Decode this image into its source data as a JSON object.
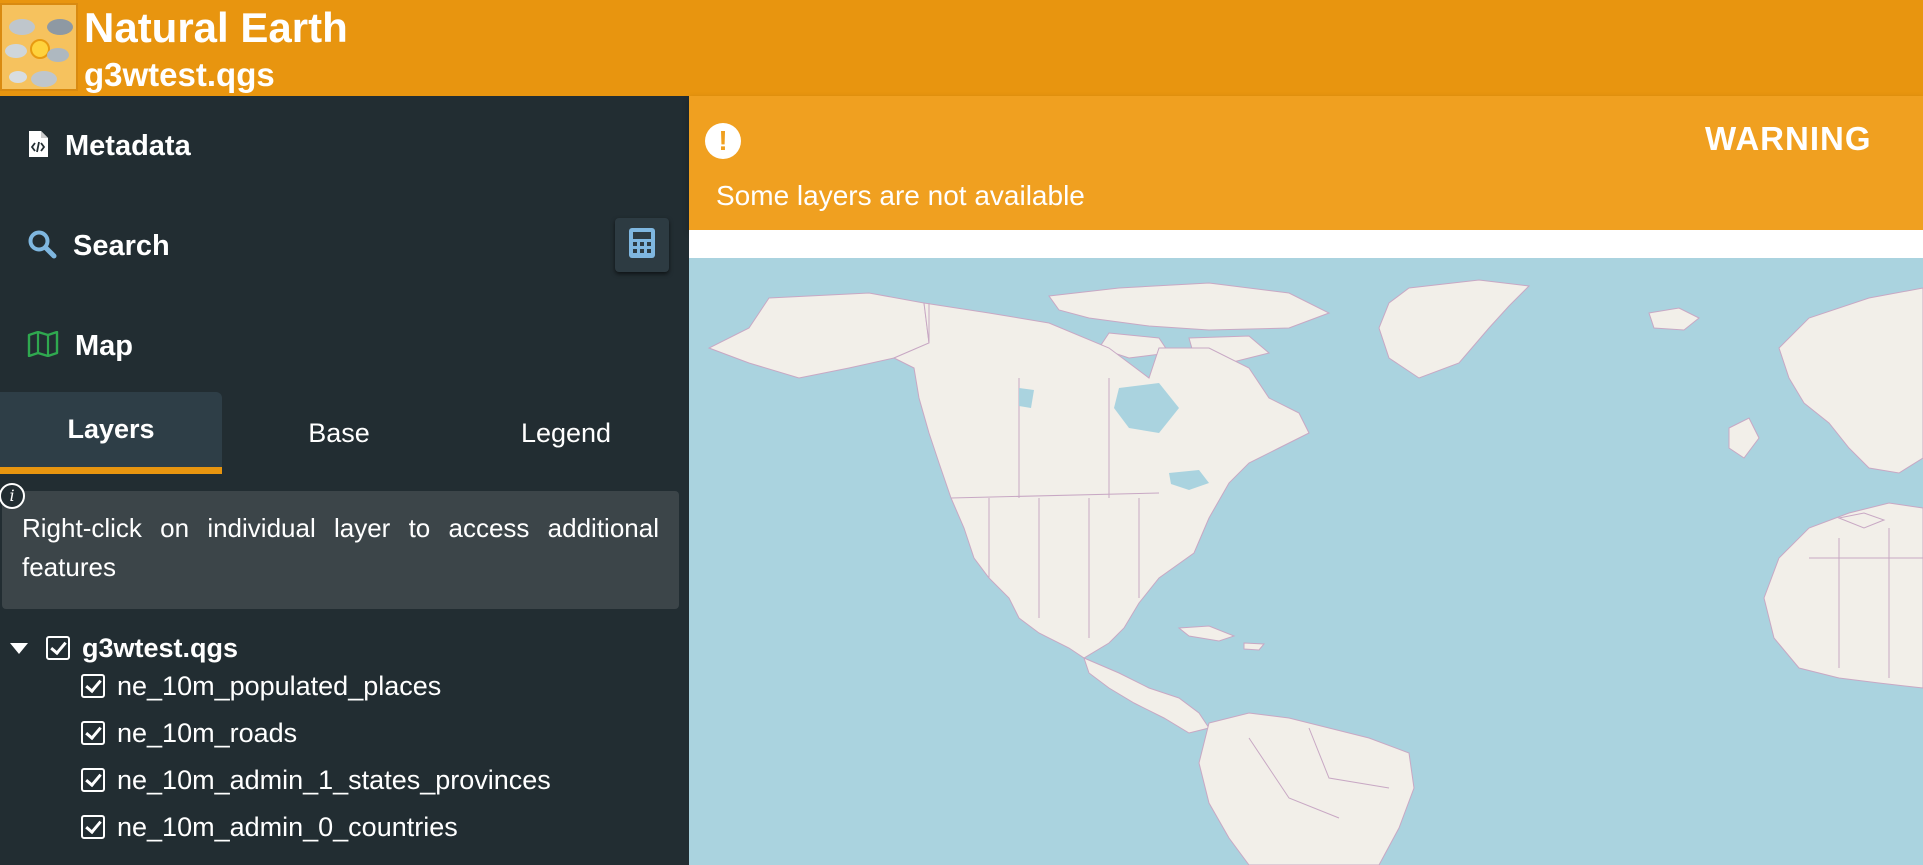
{
  "header": {
    "app_title": "Natural Earth",
    "project_title": "g3wtest.qgs",
    "background_color": "#e8950f"
  },
  "sidebar": {
    "nav": [
      {
        "label": "Metadata",
        "icon": "file-code-icon"
      },
      {
        "label": "Search",
        "icon": "search-icon"
      },
      {
        "label": "Map",
        "icon": "map-icon"
      }
    ],
    "calculator_icon": "calculator-icon",
    "tabs": [
      {
        "label": "Layers",
        "active": true
      },
      {
        "label": "Base",
        "active": false
      },
      {
        "label": "Legend",
        "active": false
      }
    ],
    "info_text": "Right-click on individual layer to access additional features",
    "tree": {
      "root": {
        "label": "g3wtest.qgs",
        "checked": true,
        "expanded": true
      },
      "layers": [
        {
          "label": "ne_10m_populated_places",
          "checked": true
        },
        {
          "label": "ne_10m_roads",
          "checked": true
        },
        {
          "label": "ne_10m_admin_1_states_provinces",
          "checked": true
        },
        {
          "label": "ne_10m_admin_0_countries",
          "checked": true
        }
      ]
    }
  },
  "warning": {
    "title": "WARNING",
    "message": "Some layers are not available",
    "color": "#f0a020"
  },
  "map": {
    "water_color": "#aad3df",
    "land_color": "#f2efe9",
    "border_color": "#c8a8c4"
  }
}
